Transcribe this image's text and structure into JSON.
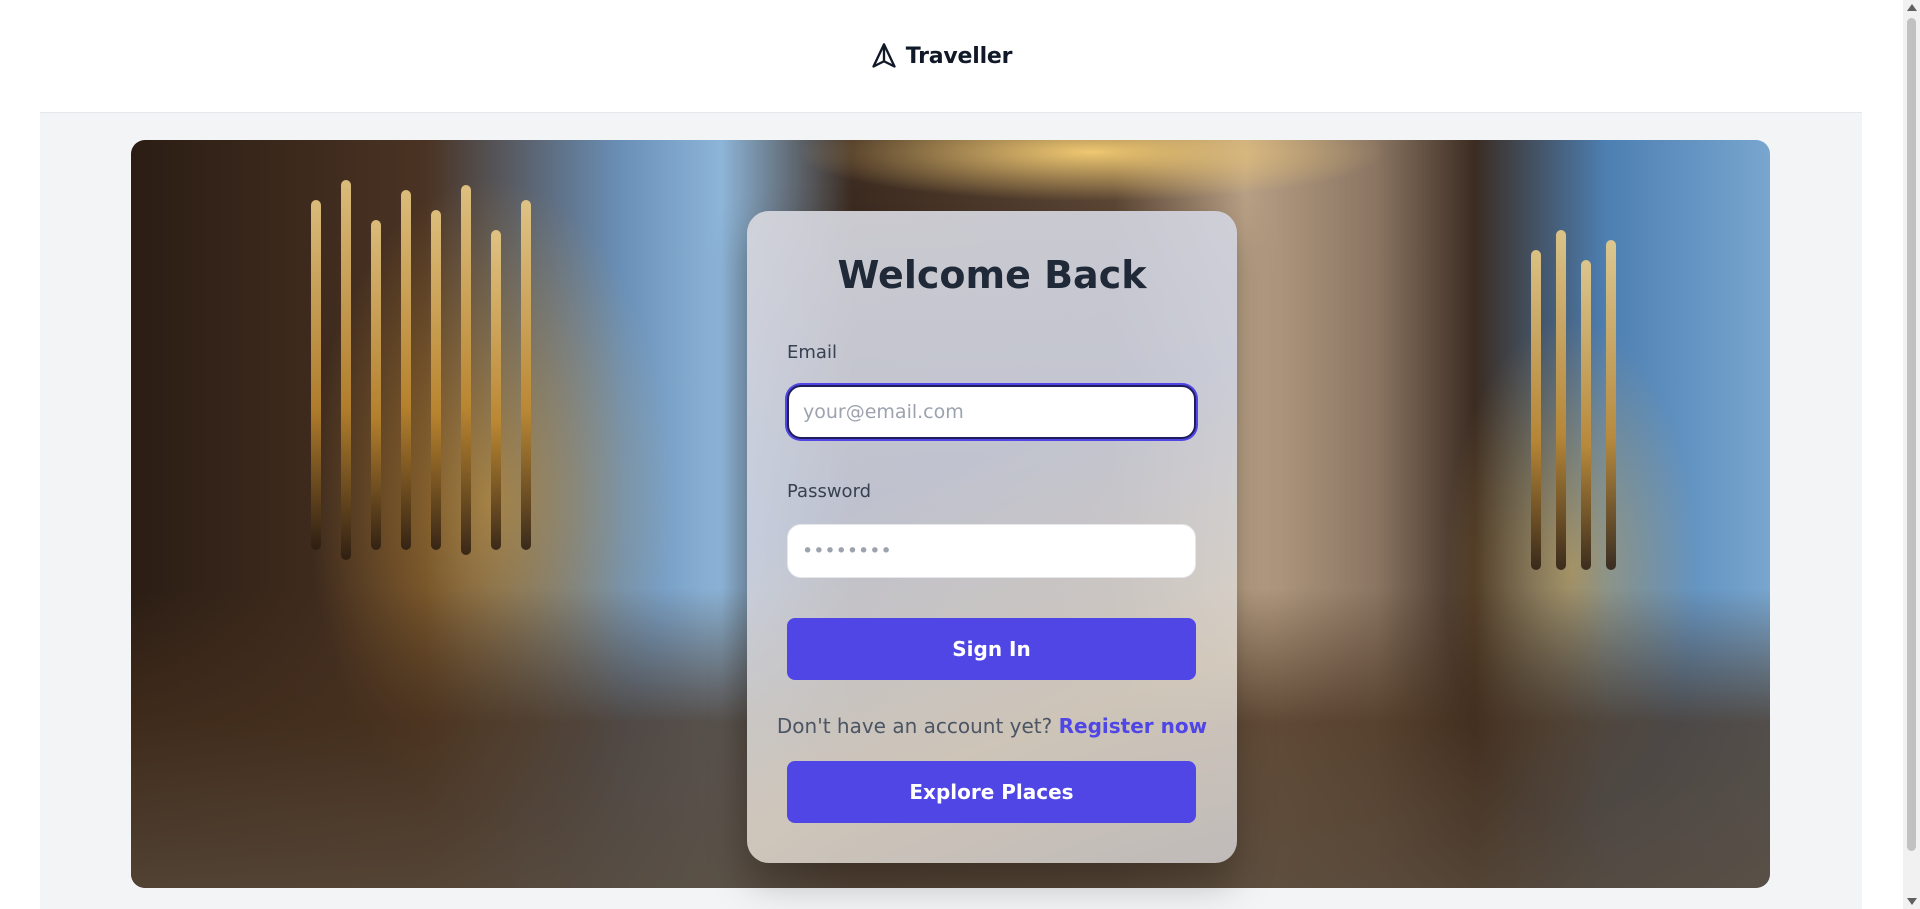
{
  "header": {
    "brand_name": "Traveller",
    "brand_icon": "navigation-arrow-icon"
  },
  "login": {
    "title": "Welcome Back",
    "email_label": "Email",
    "email_placeholder": "your@email.com",
    "email_value": "",
    "password_label": "Password",
    "password_placeholder": "••••••••",
    "password_value": "",
    "sign_in_label": "Sign In",
    "register_prompt": "Don't have an account yet?",
    "register_link": "Register now",
    "explore_label": "Explore Places"
  },
  "colors": {
    "accent": "#4f46e5",
    "page_bg": "#f3f4f6",
    "title": "#1f2937"
  }
}
